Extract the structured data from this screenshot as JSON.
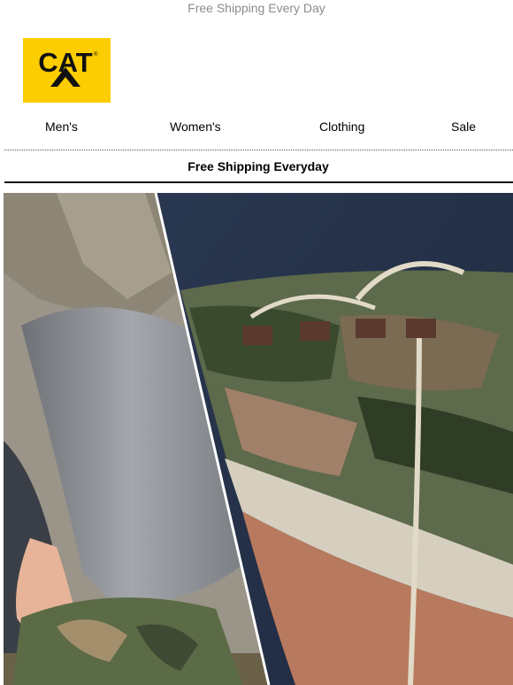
{
  "preheader": {
    "text": "Free Shipping Every Day"
  },
  "logo": {
    "text": "CAT",
    "trademark": "®",
    "brand_color": "#fccd00"
  },
  "nav": {
    "items": [
      {
        "label": "Men's"
      },
      {
        "label": "Women's"
      },
      {
        "label": "Clothing"
      },
      {
        "label": "Sale"
      }
    ]
  },
  "banner": {
    "text": "Free Shipping Everyday"
  },
  "hero": {
    "icon": "camo-sneaker-photo"
  }
}
